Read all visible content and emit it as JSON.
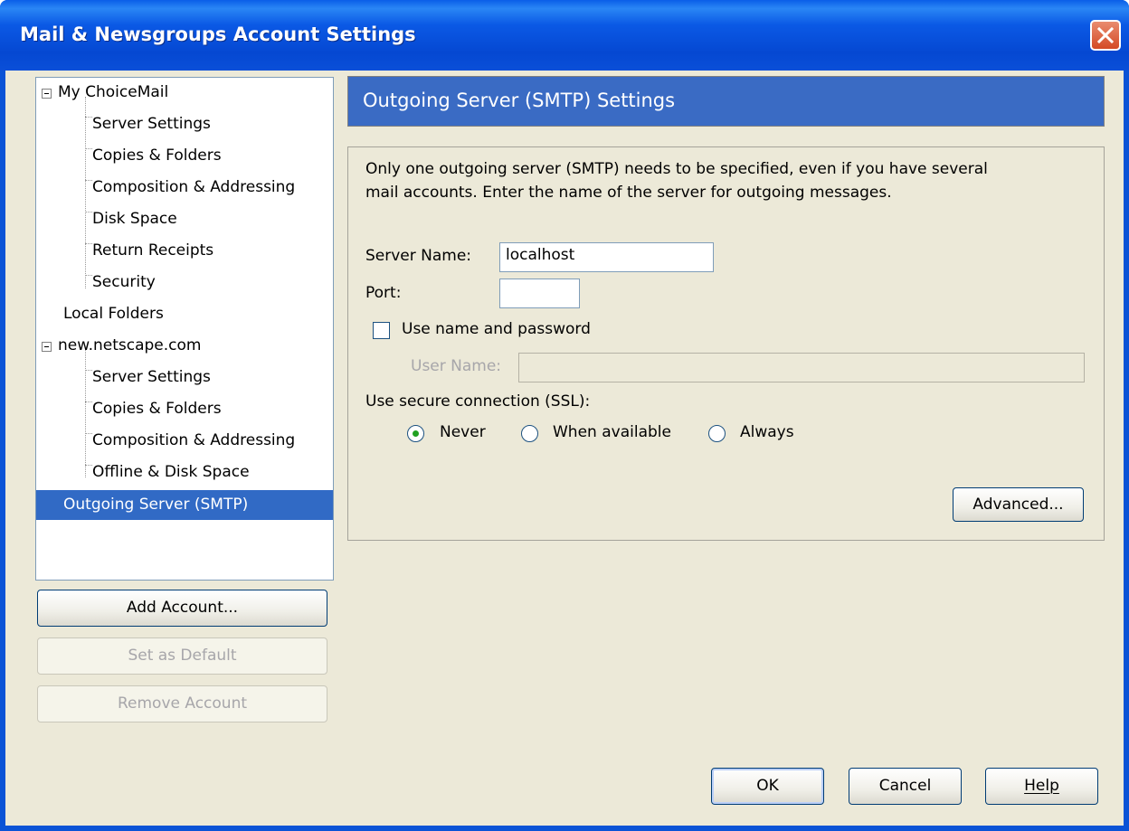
{
  "window": {
    "title": "Mail & Newsgroups Account Settings"
  },
  "tree": {
    "items": [
      {
        "label": "My ChoiceMail",
        "level": 0,
        "expander": true
      },
      {
        "label": "Server Settings",
        "level": 1
      },
      {
        "label": "Copies & Folders",
        "level": 1
      },
      {
        "label": "Composition & Addressing",
        "level": 1
      },
      {
        "label": "Disk Space",
        "level": 1
      },
      {
        "label": "Return Receipts",
        "level": 1
      },
      {
        "label": "Security",
        "level": 1
      },
      {
        "label": "Local Folders",
        "level": 0
      },
      {
        "label": "new.netscape.com",
        "level": 0,
        "expander": true
      },
      {
        "label": "Server Settings",
        "level": 1
      },
      {
        "label": "Copies & Folders",
        "level": 1
      },
      {
        "label": "Composition & Addressing",
        "level": 1
      },
      {
        "label": "Offline & Disk Space",
        "level": 1
      },
      {
        "label": "Outgoing Server (SMTP)",
        "level": 0,
        "selected": true
      }
    ]
  },
  "account_buttons": {
    "add": "Add Account...",
    "set_default": "Set as Default",
    "remove": "Remove Account"
  },
  "panel": {
    "header": "Outgoing Server (SMTP) Settings",
    "description_line1": "Only one outgoing server (SMTP) needs to be specified, even if you have several",
    "description_line2": "mail accounts. Enter the name of the server for outgoing messages.",
    "server_name_label": "Server Name:",
    "server_name_value": "localhost",
    "port_label": "Port:",
    "port_value": "",
    "use_password_label": "Use name and password",
    "use_password_checked": false,
    "username_label": "User Name:",
    "username_value": "",
    "ssl_label": "Use secure connection (SSL):",
    "ssl_options": [
      "Never",
      "When available",
      "Always"
    ],
    "ssl_selected": "Never",
    "advanced_button": "Advanced..."
  },
  "dialog_buttons": {
    "ok": "OK",
    "cancel": "Cancel",
    "help": "Help"
  }
}
